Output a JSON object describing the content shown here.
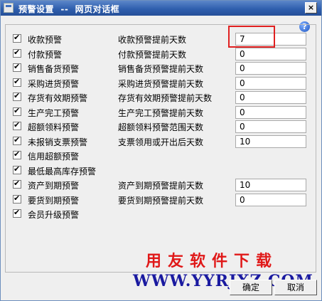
{
  "window": {
    "title": "预警设置  --  网页对话框",
    "close_label": "×"
  },
  "help_label": "?",
  "rows": [
    {
      "checked": true,
      "label": "收款预警",
      "field_label": "收款预警提前天数",
      "value": "7"
    },
    {
      "checked": true,
      "label": "付款预警",
      "field_label": "付款预警提前天数",
      "value": "0"
    },
    {
      "checked": true,
      "label": "销售备货预警",
      "field_label": "销售备货预警提前天数",
      "value": "0"
    },
    {
      "checked": true,
      "label": "采购进货预警",
      "field_label": "采购进货预警提前天数",
      "value": "0"
    },
    {
      "checked": true,
      "label": "存货有效期预警",
      "field_label": "存货有效期预警提前天数",
      "value": "0"
    },
    {
      "checked": true,
      "label": "生产完工预警",
      "field_label": "生产完工预警提前天数",
      "value": "0"
    },
    {
      "checked": true,
      "label": "超额领料预警",
      "field_label": "超额领料预警范围天数",
      "value": "0"
    },
    {
      "checked": true,
      "label": "未报销支票预警",
      "field_label": "支票领用或开出后天数",
      "value": "10"
    },
    {
      "checked": true,
      "label": "信用超额预警"
    },
    {
      "checked": true,
      "label": "最低最高库存预警"
    },
    {
      "checked": true,
      "label": "资产到期预警",
      "field_label": "资产到期预警提前天数",
      "value": "10"
    },
    {
      "checked": true,
      "label": "要货到期预警",
      "field_label": "要货到期预警提前天数",
      "value": "0"
    },
    {
      "checked": true,
      "label": "会员升级预警"
    }
  ],
  "watermark": {
    "text": "用友软件下载",
    "url": "WWW.YYRJXZ.COM"
  },
  "buttons": {
    "ok": "确定",
    "cancel": "取消"
  },
  "colors": {
    "titlebar": "#2f5fae",
    "highlight": "#e02020",
    "watermark_text": "#e01818",
    "watermark_url": "#1a1aa0"
  }
}
